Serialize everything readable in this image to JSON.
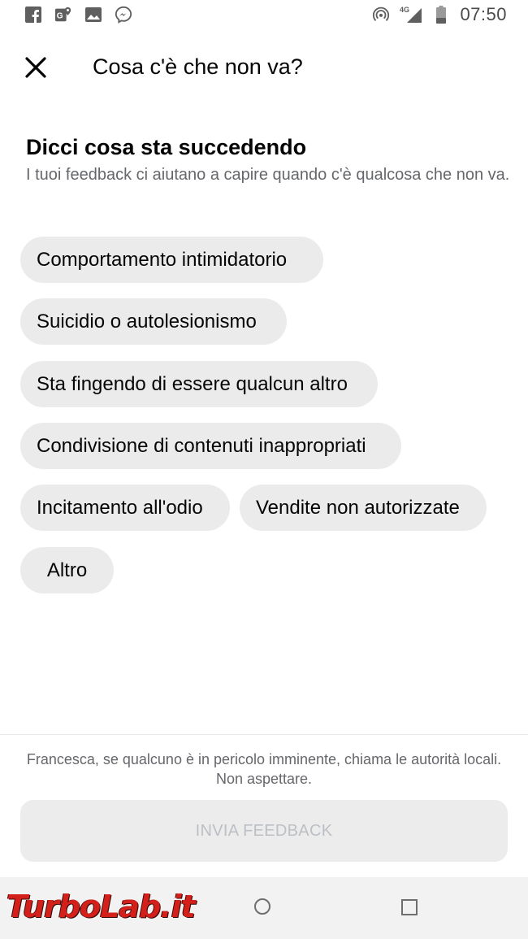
{
  "status_bar": {
    "time": "07:50",
    "network": "4G",
    "icons_left": [
      "facebook-icon",
      "maps-icon",
      "gallery-icon",
      "messenger-icon"
    ],
    "icons_right": [
      "hotspot-icon",
      "signal-icon",
      "battery-icon"
    ]
  },
  "header": {
    "title": "Cosa c'è che non va?",
    "close_icon": "close-icon"
  },
  "section": {
    "title": "Dicci cosa sta succedendo",
    "description": "I tuoi feedback ci aiutano a capire quando c'è qualcosa che non va."
  },
  "options": [
    {
      "label": "Comportamento intimidatorio"
    },
    {
      "label": "Suicidio o autolesionismo"
    },
    {
      "label": "Sta fingendo di essere qualcun altro"
    },
    {
      "label": "Condivisione di contenuti inappropriati"
    },
    {
      "label": "Incitamento all'odio"
    },
    {
      "label": "Vendite non autorizzate"
    },
    {
      "label": "Altro"
    }
  ],
  "footer": {
    "note": "Francesca, se qualcuno è in pericolo imminente, chiama le autorità locali. Non aspettare.",
    "submit_label": "INVIA FEEDBACK"
  },
  "navbar": {
    "watermark": "TurboLab.it"
  },
  "colors": {
    "chip_background": "#ebebeb",
    "secondary_text": "#65676b",
    "disabled_button_text": "#bcc0c4"
  }
}
